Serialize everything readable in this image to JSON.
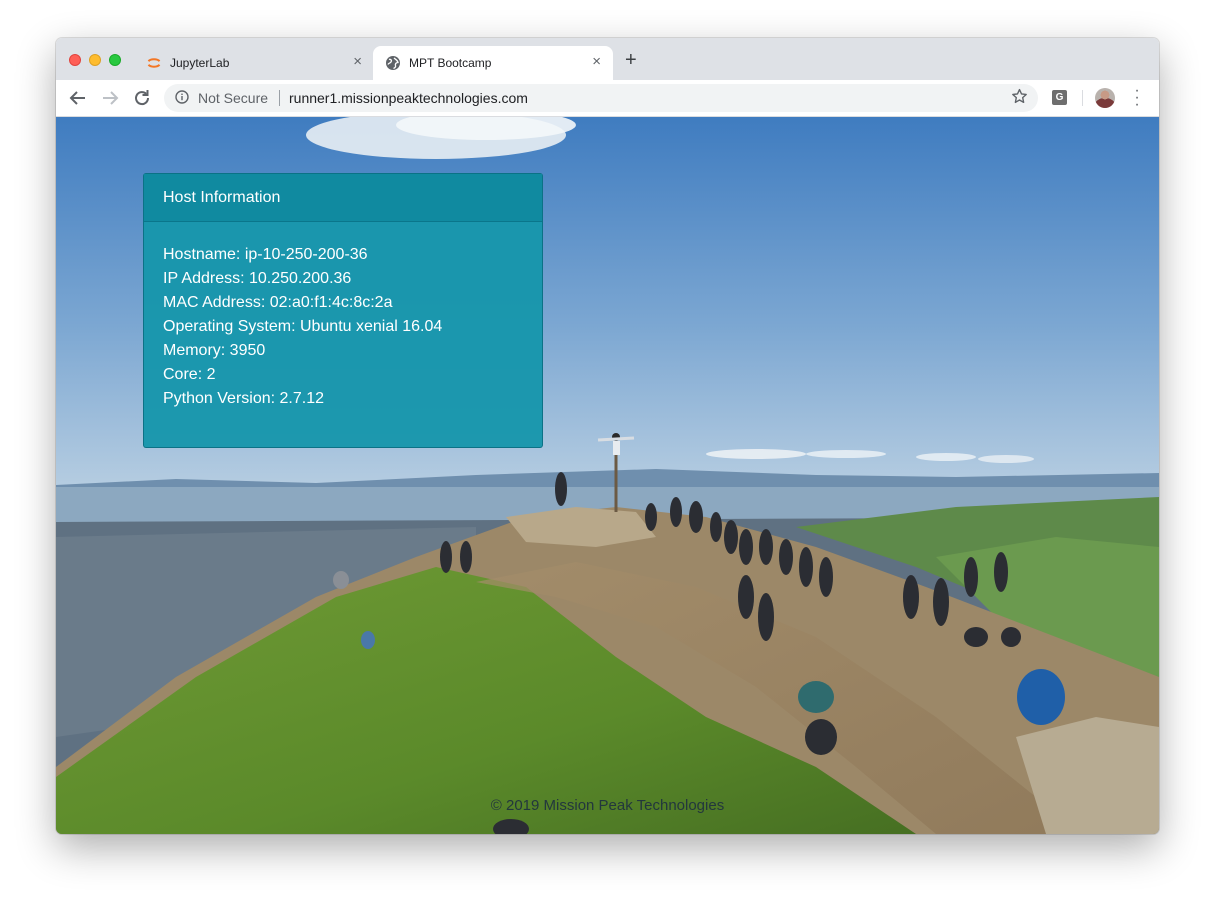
{
  "browser": {
    "tabs": [
      {
        "title": "JupyterLab",
        "active": false,
        "icon": "jupyter-icon"
      },
      {
        "title": "MPT Bootcamp",
        "active": true,
        "icon": "globe-icon"
      }
    ],
    "new_tab_label": "+",
    "close_glyph": "×",
    "security_label": "Not Secure",
    "url": "runner1.missionpeaktechnologies.com",
    "extension_label": "G",
    "colors": {
      "tabbar": "#dee1e6",
      "close": "#fe5f57",
      "minimize": "#febc2e",
      "maximize": "#28c840"
    }
  },
  "host_info": {
    "title": "Host Information",
    "rows": [
      {
        "label": "Hostname",
        "value": "ip-10-250-200-36"
      },
      {
        "label": "IP Address",
        "value": "10.250.200.36"
      },
      {
        "label": "MAC Address",
        "value": "02:a0:f1:4c:8c:2a"
      },
      {
        "label": "Operating System",
        "value": "Ubuntu xenial 16.04"
      },
      {
        "label": "Memory",
        "value": "3950"
      },
      {
        "label": "Core",
        "value": "2"
      },
      {
        "label": "Python Version",
        "value": "2.7.12"
      }
    ],
    "color": "#1796ac"
  },
  "footer": {
    "text": "© 2019 Mission Peak Technologies"
  }
}
